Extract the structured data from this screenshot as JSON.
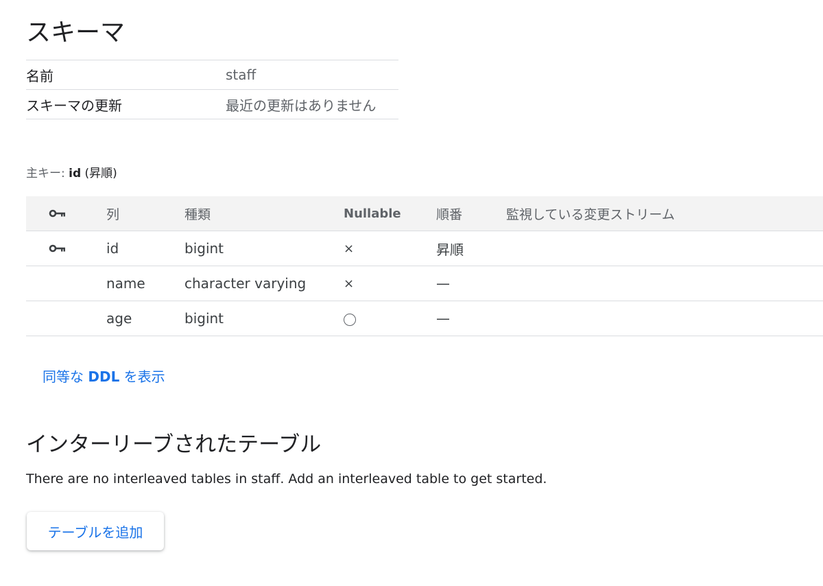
{
  "title": "スキーマ",
  "schema_meta": [
    {
      "key": "名前",
      "value": "staff"
    },
    {
      "key": "スキーマの更新",
      "value": "最近の更新はありません"
    }
  ],
  "primary_key": {
    "label": "主キー:",
    "column": "id",
    "order": "(昇順)"
  },
  "columns_table": {
    "headers": {
      "key": "key-icon",
      "column": "列",
      "type": "種類",
      "nullable": "Nullable",
      "order": "順番",
      "change_stream": "監視している変更ストリーム"
    },
    "rows": [
      {
        "is_key": true,
        "name": "id",
        "type": "bigint",
        "nullable": "×",
        "order": "昇順",
        "change_stream": ""
      },
      {
        "is_key": false,
        "name": "name",
        "type": "character varying",
        "nullable": "×",
        "order": "—",
        "change_stream": ""
      },
      {
        "is_key": false,
        "name": "age",
        "type": "bigint",
        "nullable": "○",
        "order": "—",
        "change_stream": ""
      }
    ]
  },
  "ddl_link": {
    "prefix": "同等な",
    "bold": "DDL",
    "suffix": "を表示"
  },
  "interleaved": {
    "title": "インターリーブされたテーブル",
    "empty_message": "There are no interleaved tables in staff. Add an interleaved table to get started.",
    "add_button": "テーブルを追加"
  },
  "colors": {
    "accent": "#1a73e8",
    "header_bg": "#f3f3f3",
    "divider": "#dadce0"
  }
}
